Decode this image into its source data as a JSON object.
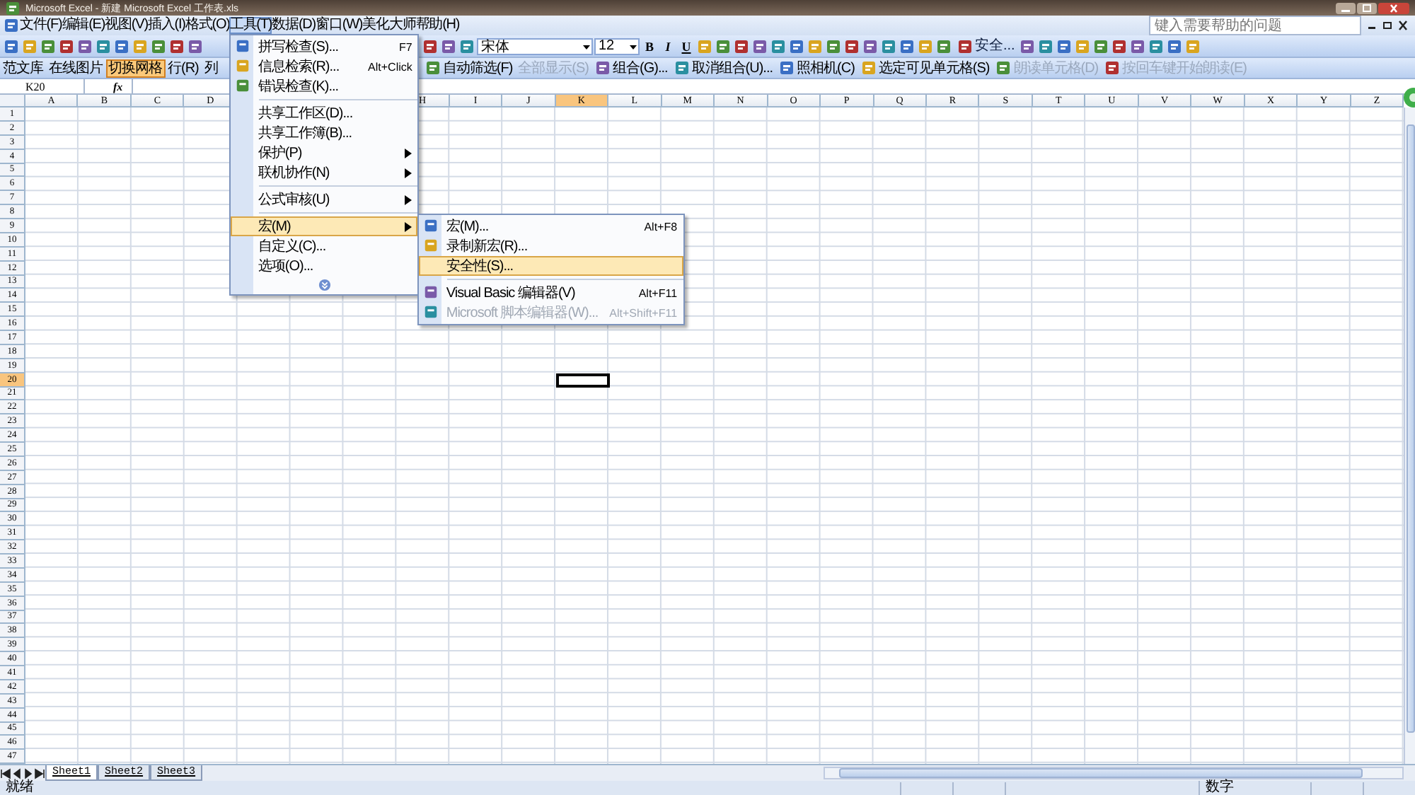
{
  "window": {
    "title": "Microsoft Excel - 新建 Microsoft Excel 工作表.xls"
  },
  "menu_bar": [
    {
      "label": "文件(F)",
      "selected": false
    },
    {
      "label": "编辑(E)",
      "selected": false
    },
    {
      "label": "视图(V)",
      "selected": false
    },
    {
      "label": "插入(I)",
      "selected": false
    },
    {
      "label": "格式(O)",
      "selected": false
    },
    {
      "label": "工具(T)",
      "selected": true
    },
    {
      "label": "数据(D)",
      "selected": false
    },
    {
      "label": "窗口(W)",
      "selected": false
    },
    {
      "label": "美化大师",
      "selected": false
    },
    {
      "label": "帮助(H)",
      "selected": false
    }
  ],
  "help_box": {
    "placeholder": "键入需要帮助的问题"
  },
  "standard_toolbar": {
    "font": "宋体",
    "font_size": "12",
    "style_buttons": [
      "B",
      "I",
      "U"
    ],
    "security_button": "安全..."
  },
  "toolbar_2": {
    "items_before_menu": [
      {
        "label": "范文库",
        "selected": false,
        "disabled": false
      },
      {
        "label": "在线图片",
        "selected": false,
        "disabled": false
      },
      {
        "label": "切换网格",
        "selected": true,
        "disabled": false
      },
      {
        "label": "行(R)",
        "selected": false,
        "disabled": false
      },
      {
        "label": "列",
        "selected": false,
        "disabled": false
      }
    ],
    "items_after_menu": [
      {
        "label": "自动筛选(F)",
        "selected": false,
        "disabled": false
      },
      {
        "label": "全部显示(S)",
        "selected": false,
        "disabled": true
      },
      {
        "label": "组合(G)...",
        "selected": false,
        "disabled": false
      },
      {
        "label": "取消组合(U)...",
        "selected": false,
        "disabled": false
      },
      {
        "label": "照相机(C)",
        "selected": false,
        "disabled": false
      },
      {
        "label": "选定可见单元格(S)",
        "selected": false,
        "disabled": false
      },
      {
        "label": "朗读单元格(D)",
        "selected": false,
        "disabled": true
      },
      {
        "label": "按回车键开始朗读(E)",
        "selected": false,
        "disabled": true
      }
    ]
  },
  "formula_bar": {
    "name_box": "K20",
    "function_label": "fx"
  },
  "tools_menu": {
    "items": [
      {
        "kind": "item",
        "label": "拼写检查(S)...",
        "shortcut": "F7",
        "has_icon": true,
        "submenu": false,
        "selected": false,
        "disabled": false
      },
      {
        "kind": "item",
        "label": "信息检索(R)...",
        "shortcut": "Alt+Click",
        "has_icon": true,
        "submenu": false,
        "selected": false,
        "disabled": false
      },
      {
        "kind": "item",
        "label": "错误检查(K)...",
        "has_icon": true,
        "submenu": false,
        "selected": false,
        "disabled": false
      },
      {
        "kind": "separator"
      },
      {
        "kind": "item",
        "label": "共享工作区(D)...",
        "has_icon": false,
        "submenu": false,
        "selected": false,
        "disabled": false
      },
      {
        "kind": "item",
        "label": "共享工作簿(B)...",
        "has_icon": false,
        "submenu": false,
        "selected": false,
        "disabled": false
      },
      {
        "kind": "item",
        "label": "保护(P)",
        "has_icon": false,
        "submenu": true,
        "selected": false,
        "disabled": false
      },
      {
        "kind": "item",
        "label": "联机协作(N)",
        "has_icon": false,
        "submenu": true,
        "selected": false,
        "disabled": false
      },
      {
        "kind": "separator"
      },
      {
        "kind": "item",
        "label": "公式审核(U)",
        "has_icon": false,
        "submenu": true,
        "selected": false,
        "disabled": false
      },
      {
        "kind": "separator"
      },
      {
        "kind": "item",
        "label": "宏(M)",
        "has_icon": false,
        "submenu": true,
        "selected": true,
        "disabled": false
      },
      {
        "kind": "item",
        "label": "自定义(C)...",
        "has_icon": false,
        "submenu": false,
        "selected": false,
        "disabled": false
      },
      {
        "kind": "item",
        "label": "选项(O)...",
        "has_icon": false,
        "submenu": false,
        "selected": false,
        "disabled": false
      },
      {
        "kind": "expand"
      }
    ]
  },
  "macro_submenu": {
    "items": [
      {
        "kind": "item",
        "label": "宏(M)...",
        "shortcut": "Alt+F8",
        "has_icon": true,
        "submenu": false,
        "selected": false,
        "disabled": false
      },
      {
        "kind": "item",
        "label": "录制新宏(R)...",
        "has_icon": true,
        "submenu": false,
        "selected": false,
        "disabled": false
      },
      {
        "kind": "item",
        "label": "安全性(S)...",
        "has_icon": false,
        "submenu": false,
        "selected": true,
        "disabled": false
      },
      {
        "kind": "separator"
      },
      {
        "kind": "item",
        "label": "Visual Basic 编辑器(V)",
        "shortcut": "Alt+F11",
        "has_icon": true,
        "submenu": false,
        "selected": false,
        "disabled": false
      },
      {
        "kind": "item",
        "label": "Microsoft 脚本编辑器(W)...",
        "shortcut": "Alt+Shift+F11",
        "has_icon": true,
        "submenu": false,
        "selected": false,
        "disabled": true
      }
    ]
  },
  "columns": [
    {
      "label": "A",
      "selected": false
    },
    {
      "label": "B",
      "selected": false
    },
    {
      "label": "C",
      "selected": false
    },
    {
      "label": "D",
      "selected": false
    },
    {},
    {},
    {},
    {
      "label": "H",
      "selected": false
    },
    {
      "label": "I",
      "selected": false
    },
    {
      "label": "J",
      "selected": false
    },
    {
      "label": "K",
      "selected": true
    },
    {
      "label": "L",
      "selected": false
    },
    {
      "label": "M",
      "selected": false
    },
    {
      "label": "N",
      "selected": false
    },
    {
      "label": "O",
      "selected": false
    },
    {
      "label": "P",
      "selected": false
    },
    {
      "label": "Q",
      "selected": false
    },
    {
      "label": "R",
      "selected": false
    },
    {
      "label": "S",
      "selected": false
    },
    {
      "label": "T",
      "selected": false
    },
    {
      "label": "U",
      "selected": false
    },
    {
      "label": "V",
      "selected": false
    },
    {
      "label": "W",
      "selected": false
    },
    {
      "label": "X",
      "selected": false
    },
    {
      "label": "Y",
      "selected": false
    },
    {
      "label": "Z",
      "selected": false
    }
  ],
  "rows": [
    {
      "label": "1",
      "selected": false
    },
    {
      "label": "2",
      "selected": false
    },
    {
      "label": "3",
      "selected": false
    },
    {
      "label": "4",
      "selected": false
    },
    {
      "label": "5",
      "selected": false
    },
    {
      "label": "6",
      "selected": false
    },
    {
      "label": "7",
      "selected": false
    },
    {
      "label": "8",
      "selected": false
    },
    {
      "label": "9",
      "selected": false
    },
    {
      "label": "10",
      "selected": false
    },
    {
      "label": "11",
      "selected": false
    },
    {
      "label": "12",
      "selected": false
    },
    {
      "label": "13",
      "selected": false
    },
    {
      "label": "14",
      "selected": false
    },
    {
      "label": "15",
      "selected": false
    },
    {
      "label": "16",
      "selected": false
    },
    {
      "label": "17",
      "selected": false
    },
    {
      "label": "18",
      "selected": false
    },
    {
      "label": "19",
      "selected": false
    },
    {
      "label": "20",
      "selected": true
    },
    {
      "label": "21",
      "selected": false
    },
    {
      "label": "22",
      "selected": false
    },
    {
      "label": "23",
      "selected": false
    },
    {
      "label": "24",
      "selected": false
    },
    {
      "label": "25",
      "selected": false
    },
    {
      "label": "26",
      "selected": false
    },
    {
      "label": "27",
      "selected": false
    },
    {
      "label": "28",
      "selected": false
    },
    {
      "label": "29",
      "selected": false
    },
    {
      "label": "30",
      "selected": false
    },
    {
      "label": "31",
      "selected": false
    },
    {
      "label": "32",
      "selected": false
    },
    {
      "label": "33",
      "selected": false
    },
    {
      "label": "34",
      "selected": false
    },
    {
      "label": "35",
      "selected": false
    },
    {
      "label": "36",
      "selected": false
    },
    {
      "label": "37",
      "selected": false
    },
    {
      "label": "38",
      "selected": false
    },
    {
      "label": "39",
      "selected": false
    },
    {
      "label": "40",
      "selected": false
    },
    {
      "label": "41",
      "selected": false
    },
    {
      "label": "42",
      "selected": false
    },
    {
      "label": "43",
      "selected": false
    },
    {
      "label": "44",
      "selected": false
    },
    {
      "label": "45",
      "selected": false
    },
    {
      "label": "46",
      "selected": false
    },
    {
      "label": "47",
      "selected": false
    }
  ],
  "sheet_tabs": [
    {
      "label": "Sheet1",
      "selected": true
    },
    {
      "label": "Sheet2",
      "selected": false
    },
    {
      "label": "Sheet3",
      "selected": false
    }
  ],
  "status_bar": {
    "state": "就绪",
    "mode": "数字"
  }
}
